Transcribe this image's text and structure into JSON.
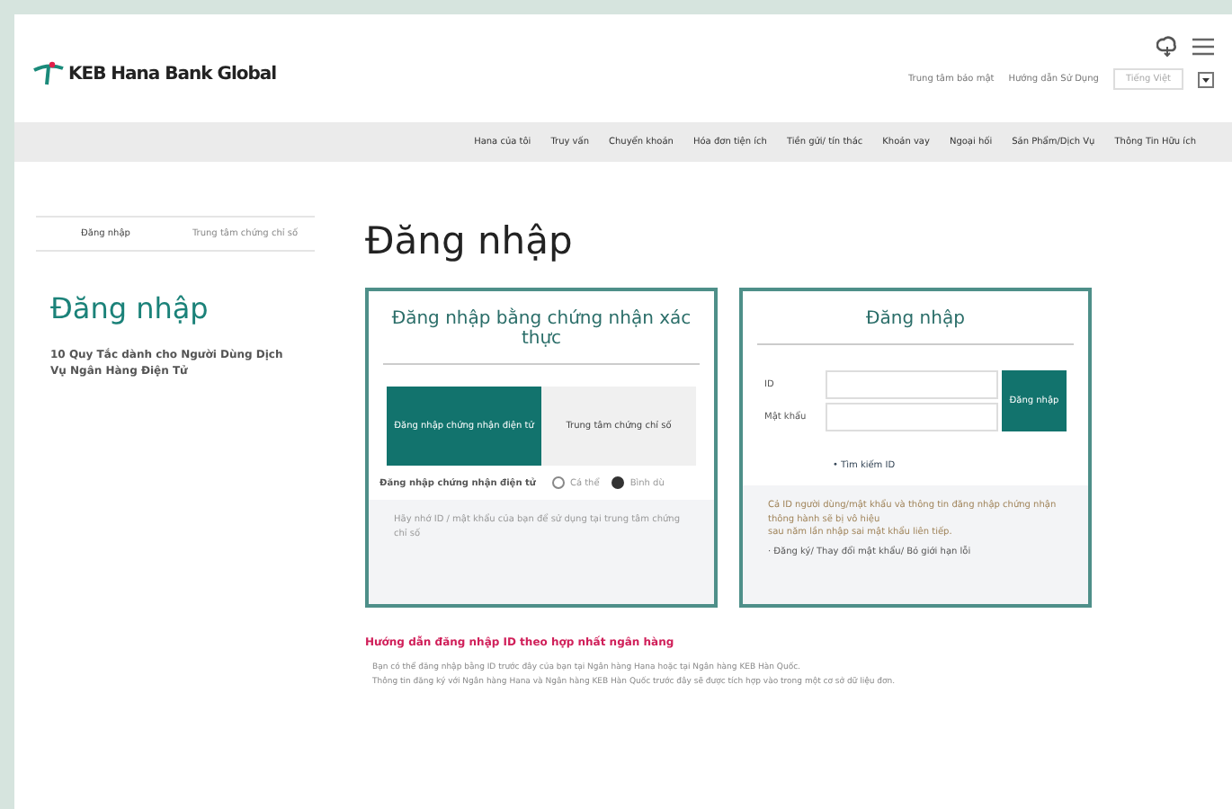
{
  "header": {
    "logo": "KEB Hana Bank  Global",
    "links": [
      "Trung tâm bảo mật",
      "Hướng dẫn Sử Dụng"
    ],
    "language": "Tiếng Việt"
  },
  "nav": [
    "Hana của tôi",
    "Truy vấn",
    "Chuyển khoản",
    "Hóa đơn tiện ích",
    "Tiền gửi/ tín thác",
    "Khoản vay",
    "Ngoại hối",
    "Sản Phẩm/Dịch Vụ",
    "Thông Tin Hữu ích"
  ],
  "sidebar": {
    "tabs": [
      {
        "label": "Đăng nhập",
        "selected": true
      },
      {
        "label": "Trung tâm chứng chỉ số",
        "selected": false
      }
    ],
    "title": "Đăng nhập",
    "link": "10 Quy Tắc dành cho Người Dùng Dịch Vụ Ngân Hàng Điện Tử"
  },
  "page_title": "Đăng nhập",
  "cert_panel": {
    "title": "Đăng nhập bằng chứng nhận xác thực",
    "tabs": [
      {
        "label": "Đăng nhập chứng nhận điện tử",
        "selected": true
      },
      {
        "label": "Trung tâm chứng chỉ số",
        "selected": false
      }
    ],
    "option_label": "Đăng nhập chứng nhận điện tử",
    "options": [
      {
        "label": "Cá thể",
        "selected": false
      },
      {
        "label": "Bình dù",
        "selected": true
      }
    ],
    "note": "Hãy nhớ ID / mật khẩu của bạn để sử dụng tại trung tâm chứng chỉ số"
  },
  "login_panel": {
    "title": "Đăng nhập",
    "id_label": "ID",
    "password_label": "Mật khẩu",
    "button": "Đăng nhập",
    "find_id": "• Tìm kiếm ID",
    "note": [
      "Cả ID người dùng/mật khẩu và thông tin đăng nhập chứng nhận thông hành sẽ bị vô hiệu",
      "sau năm lần nhập sai mật khẩu liên tiếp."
    ],
    "links": "· Đăng ký/ Thay đổi mật khẩu/ Bỏ giới hạn lỗi"
  },
  "guide": {
    "title": "Hướng dẫn đăng nhập ID theo hợp nhất ngân hàng",
    "items": [
      "Bạn có thể đăng nhập bằng ID trước đây của bạn tại Ngân hàng Hana hoặc tại Ngân hàng KEB Hàn Quốc.",
      "Thông tin đăng ký với Ngân hàng Hana và Ngân hàng KEB Hàn Quốc trước đây sẽ được tích hợp vào trong một cơ sở dữ liệu đơn."
    ]
  }
}
